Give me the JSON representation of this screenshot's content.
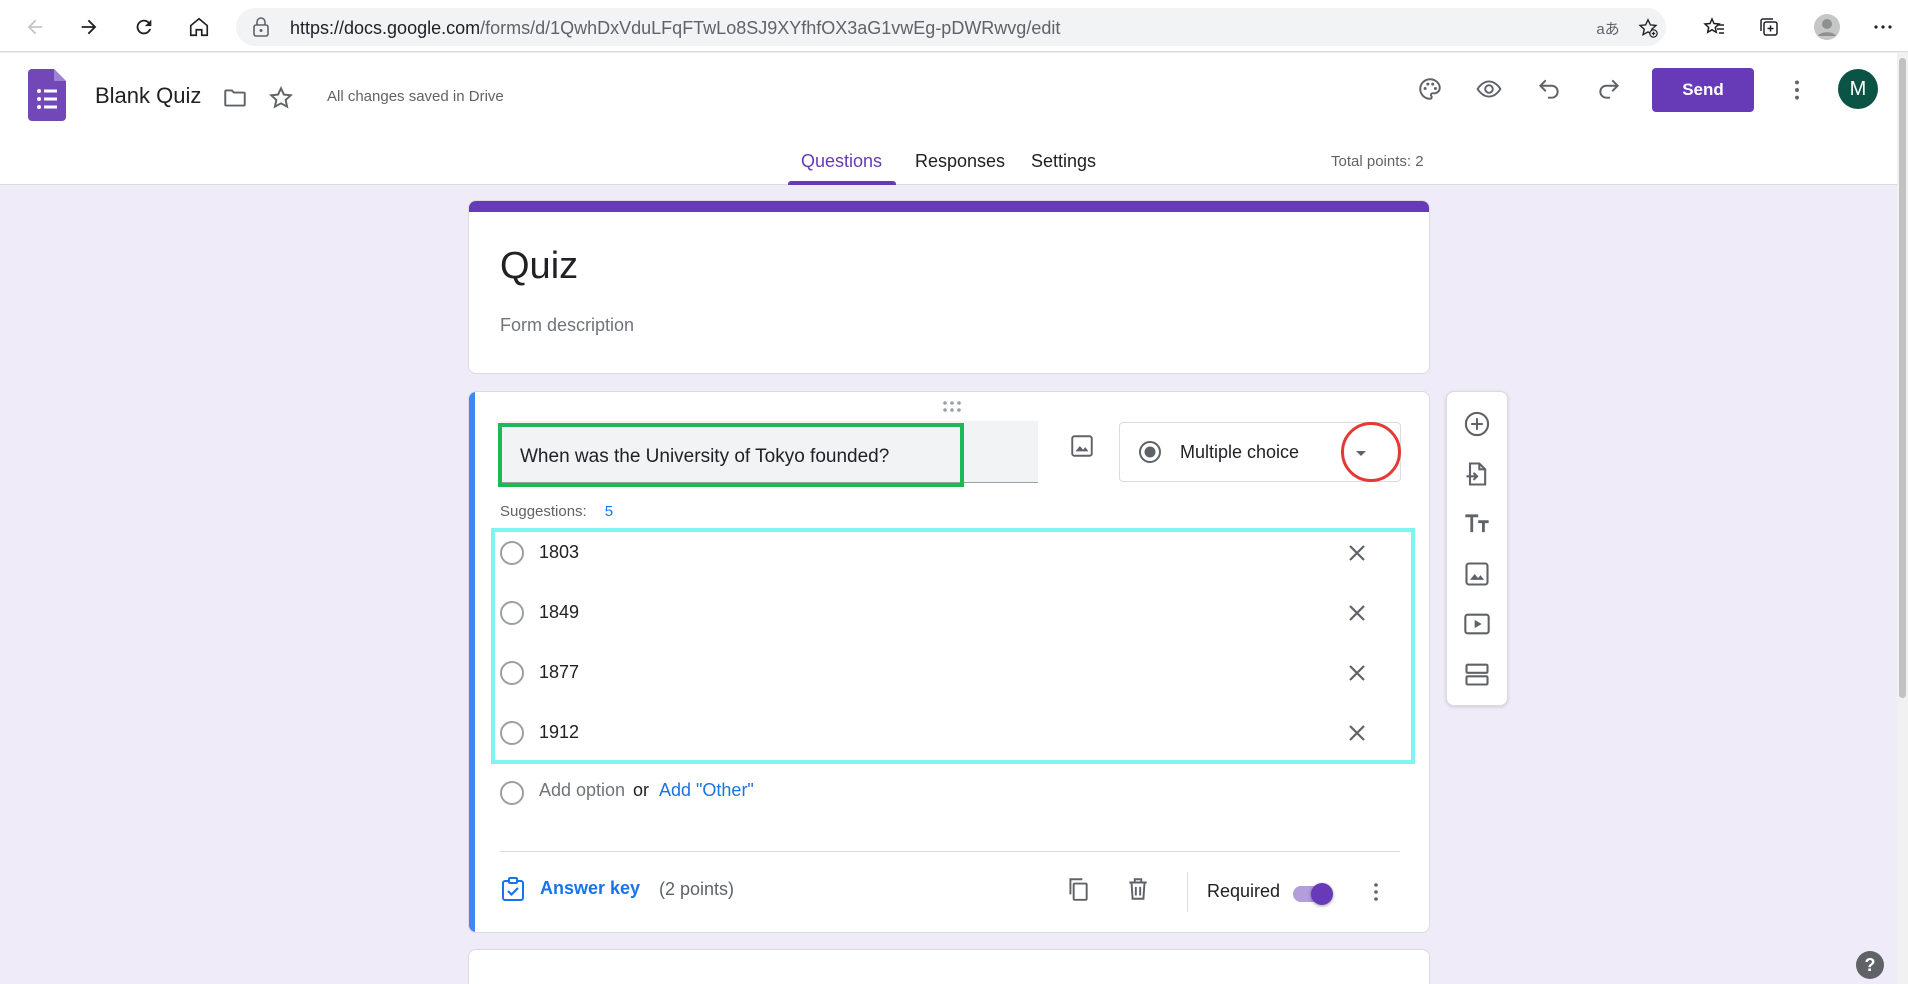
{
  "browser": {
    "url_host": "https://docs.google.com",
    "url_path": "/forms/d/1QwhDxVduLFqFTwLo8SJ9XYfhfOX3aG1vwEg-pDWRwvg/edit",
    "translate_label": "aあ"
  },
  "header": {
    "doc_title": "Blank Quiz",
    "saved_status": "All changes saved in Drive",
    "send_label": "Send",
    "avatar_letter": "M",
    "tabs": [
      {
        "label": "Questions",
        "active": true
      },
      {
        "label": "Responses",
        "active": false
      },
      {
        "label": "Settings",
        "active": false
      }
    ],
    "total_points": "Total points: 2"
  },
  "form": {
    "title": "Quiz",
    "description_placeholder": "Form description"
  },
  "question": {
    "text": "When was the University of Tokyo founded?",
    "type_label": "Multiple choice",
    "suggestions_label": "Suggestions:",
    "suggestions_count": "5",
    "options": [
      {
        "label": "1803"
      },
      {
        "label": "1849"
      },
      {
        "label": "1877"
      },
      {
        "label": "1912"
      }
    ],
    "add_option": "Add option",
    "or_text": "or",
    "add_other": "Add \"Other\"",
    "answer_key": "Answer key",
    "points": "(2 points)",
    "required_label": "Required",
    "required_on": true
  },
  "help_label": "?",
  "colors": {
    "accent": "#673ab7",
    "background": "#f0ebf8",
    "link": "#1a73e8",
    "active_bar": "#4285f4",
    "highlight_green": "#1db954",
    "highlight_cyan": "#7ff5f0",
    "highlight_red": "#e53935"
  }
}
